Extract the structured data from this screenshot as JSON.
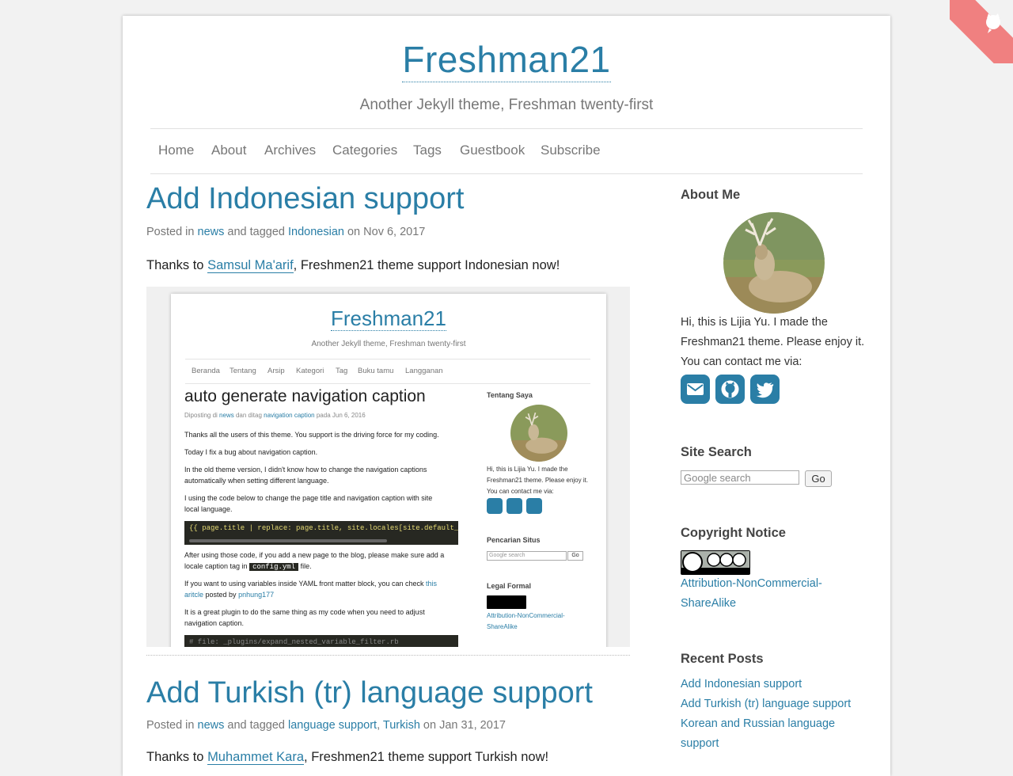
{
  "site": {
    "title": "Freshman21",
    "tagline": "Another Jekyll theme, Freshman twenty-first"
  },
  "nav": {
    "items": [
      "Home",
      "About",
      "Archives",
      "Categories",
      "Tags",
      "Guestbook",
      "Subscribe"
    ]
  },
  "posts": [
    {
      "title": "Add Indonesian support",
      "meta_prefix": "Posted in",
      "category": "news",
      "meta_mid": "and tagged",
      "tags": [
        "Indonesian"
      ],
      "meta_on": "on",
      "date": "Nov 6, 2017",
      "body_prefix": "Thanks to",
      "body_link": "Samsul Ma'arif",
      "body_suffix": ", Freshmen21 theme support Indonesian now!"
    },
    {
      "title": "Add Turkish (tr) language support",
      "meta_prefix": "Posted in",
      "category": "news",
      "meta_mid": "and tagged",
      "tags": [
        "language support",
        "Turkish"
      ],
      "meta_on": "on",
      "date": "Jan 31, 2017",
      "body_prefix": "Thanks to",
      "body_link": "Muhammet Kara",
      "body_suffix": ", Freshmen21 theme support Turkish now!"
    }
  ],
  "screenshot": {
    "site_title": "Freshman21",
    "tagline": "Another Jekyll theme, Freshman twenty-first",
    "nav": [
      "Beranda",
      "Tentang",
      "Arsip",
      "Kategori",
      "Tag",
      "Buku tamu",
      "Langganan"
    ],
    "post_title": "auto generate navigation caption",
    "meta_prefix": "Diposting di",
    "category": "news",
    "meta_mid": "dan ditag",
    "tag": "navigation caption",
    "meta_on": "pada",
    "date": "Jun 6, 2016",
    "paras": [
      "Thanks all the users of this theme. You support is the driving force for my coding.",
      "Today I fix a bug about navigation caption.",
      "In the old theme version, I didn't know how to change the navigation captions",
      "automatically when setting different language.",
      "I using the code below to change the page title and navigation caption with site",
      "local language."
    ],
    "code1": "{{ page.title | replace: page.title, site.locales[site.default_loca",
    "after1": "After using those code, if you add a new page to the blog, please make sure add a",
    "after2_prefix": "locale caption tag in",
    "after2_code": "config.yml",
    "after2_suffix": "file.",
    "yaml1_prefix": "If you want to using variables inside YAML front matter block, you can check",
    "yaml1_link": "this",
    "yaml2_link": "aritcle",
    "yaml2_mid": "posted by",
    "yaml2_author": "pnhung177",
    "plugin1": "It is a great plugin to do the same thing as my code when you need to adjust",
    "plugin2": "navigation caption.",
    "code2": "# file: _plugins/expand_nested_variable_filter.rb",
    "side_about": "Tentang Saya",
    "side_bio": [
      "Hi, this is Lijia Yu. I made the",
      "Freshman21 theme. Please enjoy it.",
      "You can contact me via:"
    ],
    "side_search": "Pencarian Situs",
    "search_placeholder": "Google search",
    "search_button": "Go",
    "side_legal": "Legal Formal",
    "license": [
      "Attribution-NonCommercial-",
      "ShareAlike"
    ]
  },
  "sidebar": {
    "about_heading": "About Me",
    "bio": [
      "Hi, this is Lijia Yu. I made the",
      "Freshman21 theme. Please enjoy it.",
      "You can contact me via:"
    ],
    "social_icons": [
      "envelope-icon",
      "github-icon",
      "twitter-icon"
    ],
    "search_heading": "Site Search",
    "search_placeholder": "Google search",
    "search_button": "Go",
    "copyright_heading": "Copyright Notice",
    "cc_badge": [
      "BY",
      "NC",
      "SA"
    ],
    "license": [
      "Attribution-NonCommercial-",
      "ShareAlike"
    ],
    "recent_heading": "Recent Posts",
    "recent": [
      "Add Indonesian support",
      "Add Turkish (tr) language support",
      "Korean and Russian language",
      "support"
    ]
  },
  "colors": {
    "accent": "#2a7ea6",
    "ribbon": "#f08080"
  }
}
